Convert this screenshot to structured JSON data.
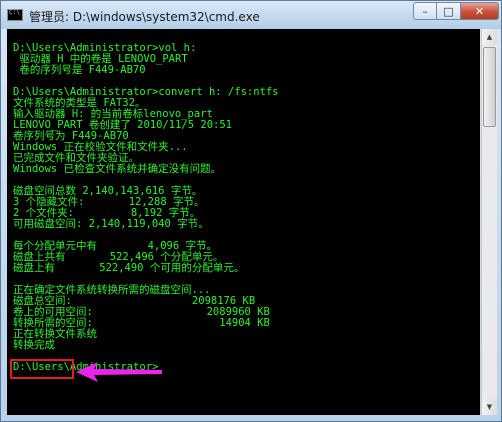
{
  "window": {
    "title": "管理员: D:\\windows\\system32\\cmd.exe",
    "controls": {
      "minimize": "–",
      "maximize": "□",
      "close": "✕"
    }
  },
  "console": {
    "lines": [
      "D:\\Users\\Administrator>vol h:",
      " 驱动器 H 中的卷是 LENOVO_PART",
      " 卷的序列号是 F449-AB70",
      "",
      "D:\\Users\\Administrator>convert h: /fs:ntfs",
      "文件系统的类型是 FAT32。",
      "输入驱动器 H: 的当前卷标lenovo_part",
      "LENOVO_PART 卷创建了 2010/11/5 20:51",
      "卷序列号为 F449-AB70",
      "Windows 正在校验文件和文件夹...",
      "已完成文件和文件夹验证。",
      "Windows 已检查文件系统并确定没有问题。",
      "",
      "磁盘空间总数 2,140,143,616 字节。",
      "3 个隐藏文件:       12,288 字节。",
      "2 个文件夹:         8,192 字节。",
      "可用磁盘空间: 2,140,119,040 字节。",
      "",
      "每个分配单元中有        4,096 字节。",
      "磁盘上共有       522,496 个分配单元。",
      "磁盘上有       522,490 个可用的分配单元。",
      "",
      "正在确定文件系统转换所需的磁盘空间...",
      "磁盘总空间:                   2098176 KB",
      "卷上的可用空间:                  2089960 KB",
      "转换所需的空间:                    14904 KB",
      "正在转换文件系统",
      "转换完成",
      "",
      "D:\\Users\\Administrator>"
    ]
  },
  "colors": {
    "console_bg": "#000000",
    "console_text": "#2cf22c",
    "highlight_border": "#e31e1e",
    "arrow": "#ee22ee"
  },
  "annotation": {
    "highlighted_text": "转换完成"
  }
}
